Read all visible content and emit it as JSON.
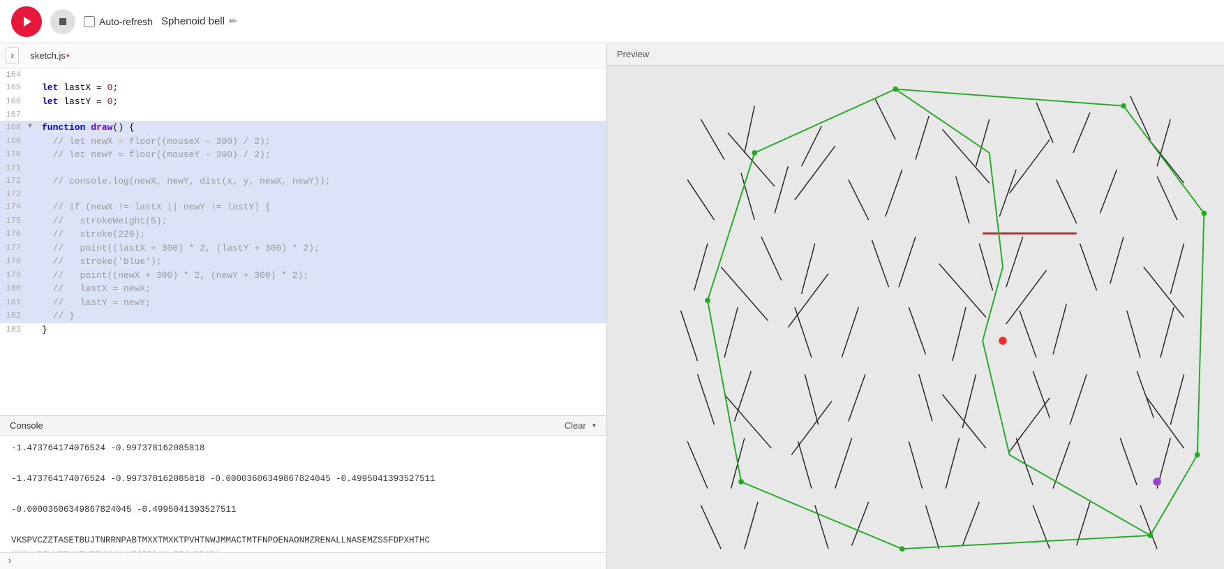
{
  "toolbar": {
    "play_label": "▶",
    "stop_label": "■",
    "auto_refresh_label": "Auto-refresh",
    "sketch_name": "Sphenoid bell",
    "edit_icon": "✏"
  },
  "editor": {
    "tab_arrow": "›",
    "filename": "sketch.js",
    "modified_dot": "•",
    "lines": [
      {
        "num": "164",
        "content": "",
        "highlight": false,
        "fold": false
      },
      {
        "num": "165",
        "content": "let lastX = 0;",
        "highlight": false,
        "fold": false
      },
      {
        "num": "166",
        "content": "let lastY = 0;",
        "highlight": false,
        "fold": false
      },
      {
        "num": "167",
        "content": "",
        "highlight": false,
        "fold": false
      },
      {
        "num": "168",
        "content": "function draw() {",
        "highlight": true,
        "fold": true
      },
      {
        "num": "169",
        "content": "  // let newX = floor((mouseX - 300) / 2);",
        "highlight": true,
        "fold": false
      },
      {
        "num": "170",
        "content": "  // let newY = floor((mouseY - 300) / 2);",
        "highlight": true,
        "fold": false
      },
      {
        "num": "171",
        "content": "",
        "highlight": true,
        "fold": false
      },
      {
        "num": "172",
        "content": "  // console.log(newX, newY, dist(x, y, newX, newY));",
        "highlight": true,
        "fold": false
      },
      {
        "num": "173",
        "content": "",
        "highlight": true,
        "fold": false
      },
      {
        "num": "174",
        "content": "  // if (newX != lastX || newY != lastY) {",
        "highlight": true,
        "fold": false
      },
      {
        "num": "175",
        "content": "  //   strokeWeight(5);",
        "highlight": true,
        "fold": false
      },
      {
        "num": "176",
        "content": "  //   stroke(220);",
        "highlight": true,
        "fold": false
      },
      {
        "num": "177",
        "content": "  //   point((lastX + 300) * 2, (lastY + 300) * 2);",
        "highlight": true,
        "fold": false
      },
      {
        "num": "178",
        "content": "  //   stroke('blue');",
        "highlight": true,
        "fold": false
      },
      {
        "num": "179",
        "content": "  //   point((newX + 300) * 2, (newY + 300) * 2);",
        "highlight": true,
        "fold": false
      },
      {
        "num": "180",
        "content": "  //   lastX = newX;",
        "highlight": true,
        "fold": false
      },
      {
        "num": "181",
        "content": "  //   lastY = newY;",
        "highlight": true,
        "fold": false
      },
      {
        "num": "182",
        "content": "  // }",
        "highlight": true,
        "fold": false
      },
      {
        "num": "183",
        "content": "}",
        "highlight": false,
        "fold": false
      }
    ]
  },
  "console": {
    "title": "Console",
    "clear_label": "Clear",
    "lines": [
      "-1.473764174076524 -0.997378162085818",
      "",
      "-1.473764174076524 -0.997378162085818 -0.00003606349867824045  -0.4995041393527511",
      "",
      "-0.00003606349867824045  -0.4995041393527511",
      "",
      "VKSPVCZZTASETBUJTNRRNPABTMXXTMXKTPVHTNWJMMACTMTFNPOENAONMZRENALLNASEMZSSFDPXHTHC",
      "GNGUHPFYHZIWKTKZIKUYHLMFJEPPGMLZEJMPBJBQ"
    ]
  },
  "preview": {
    "header": "Preview"
  }
}
